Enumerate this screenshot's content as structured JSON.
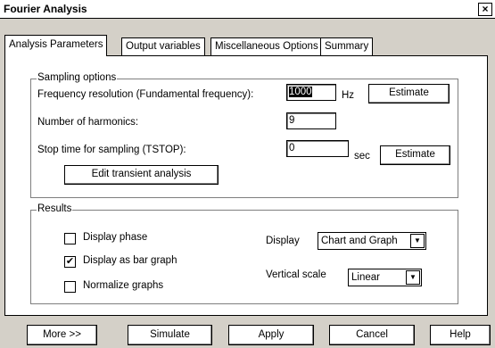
{
  "window": {
    "title": "Fourier Analysis",
    "close": "×"
  },
  "tabs": [
    {
      "label": "Analysis Parameters"
    },
    {
      "label": "Output variables"
    },
    {
      "label": "Miscellaneous Options"
    },
    {
      "label": "Summary"
    }
  ],
  "sampling": {
    "group_label": "Sampling options",
    "freq_label": "Frequency resolution (Fundamental frequency):",
    "freq_value": "1000",
    "freq_unit": "Hz",
    "harm_label": "Number of harmonics:",
    "harm_value": "9",
    "stop_label": "Stop time for sampling (TSTOP):",
    "stop_value": "0",
    "stop_unit": "sec",
    "estimate_label": "Estimate",
    "edit_transient_label": "Edit transient analysis"
  },
  "results": {
    "group_label": "Results",
    "display_phase_label": "Display phase",
    "display_phase_checked": false,
    "bar_graph_label": "Display as bar graph",
    "bar_graph_checked": true,
    "normalize_label": "Normalize graphs",
    "normalize_checked": false,
    "display_label": "Display",
    "display_value": "Chart and Graph",
    "vscale_label": "Vertical scale",
    "vscale_value": "Linear",
    "check_mark": "✔",
    "dropdown_arrow": "▼"
  },
  "buttons": {
    "more": "More >>",
    "simulate": "Simulate",
    "apply": "Apply",
    "cancel": "Cancel",
    "help": "Help"
  }
}
